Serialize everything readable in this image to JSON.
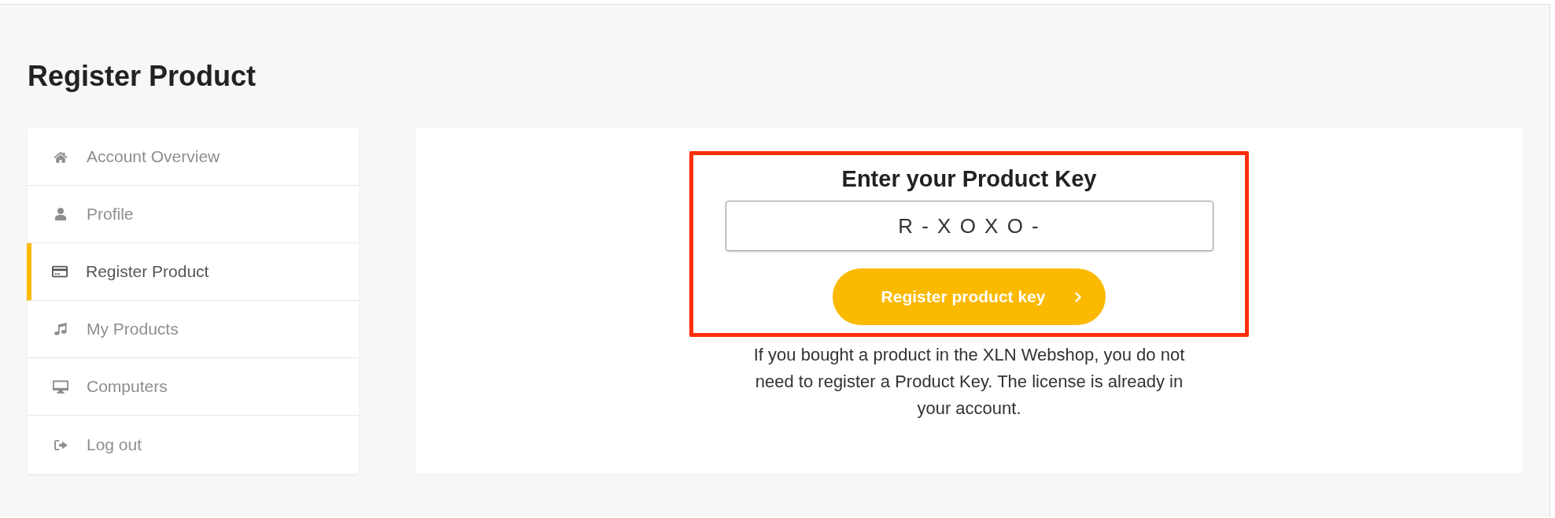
{
  "page": {
    "title": "Register Product"
  },
  "sidebar": {
    "items": [
      {
        "label": "Account Overview",
        "selected": false
      },
      {
        "label": "Profile",
        "selected": false
      },
      {
        "label": "Register Product",
        "selected": true
      },
      {
        "label": "My Products",
        "selected": false
      },
      {
        "label": "Computers",
        "selected": false
      },
      {
        "label": "Log out",
        "selected": false
      }
    ]
  },
  "key_form": {
    "highlighted": true,
    "heading": "Enter your Product Key",
    "key_field": {
      "value": "R - X O X O -"
    },
    "submit_button": {
      "label": "Register product key"
    },
    "note": "If you bought a product in the XLN Webshop, you do not need to register a Product Key. The license is already in your account."
  }
}
